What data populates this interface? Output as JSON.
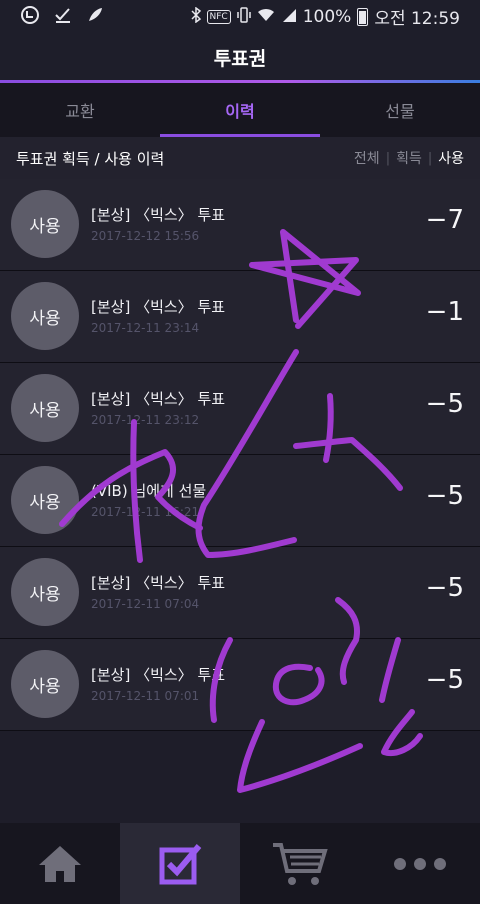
{
  "status": {
    "battery": "100%",
    "time": "오전 12:59",
    "nfc_label": "NFC"
  },
  "header": {
    "title": "투표권"
  },
  "tabs": [
    {
      "label": "교환"
    },
    {
      "label": "이력"
    },
    {
      "label": "선물"
    }
  ],
  "filter": {
    "title": "투표권 획득 / 사용 이력",
    "options": [
      "전체",
      "획득",
      "사용"
    ]
  },
  "rows": [
    {
      "badge": "사용",
      "title": "[본상] 〈빅스〉 투표",
      "date": "2017-12-12 15:56",
      "amount": "−7"
    },
    {
      "badge": "사용",
      "title": "[본상] 〈빅스〉 투표",
      "date": "2017-12-11 23:14",
      "amount": "−1"
    },
    {
      "badge": "사용",
      "title": "[본상] 〈빅스〉 투표",
      "date": "2017-12-11 23:12",
      "amount": "−5"
    },
    {
      "badge": "사용",
      "title": "(VIB) 님에게 선물",
      "date": "2017-12-11 16:21",
      "amount": "−5"
    },
    {
      "badge": "사용",
      "title": "[본상] 〈빅스〉 투표",
      "date": "2017-12-11 07:04",
      "amount": "−5"
    },
    {
      "badge": "사용",
      "title": "[본상] 〈빅스〉 투표",
      "date": "2017-12-11 07:01",
      "amount": "−5"
    }
  ],
  "colors": {
    "accent": "#8a4de0",
    "background": "#1e1d29",
    "scribble": "#a03ad0"
  },
  "icons": {
    "nav": [
      "home-icon",
      "checklist-icon",
      "cart-icon",
      "more-icon"
    ]
  }
}
